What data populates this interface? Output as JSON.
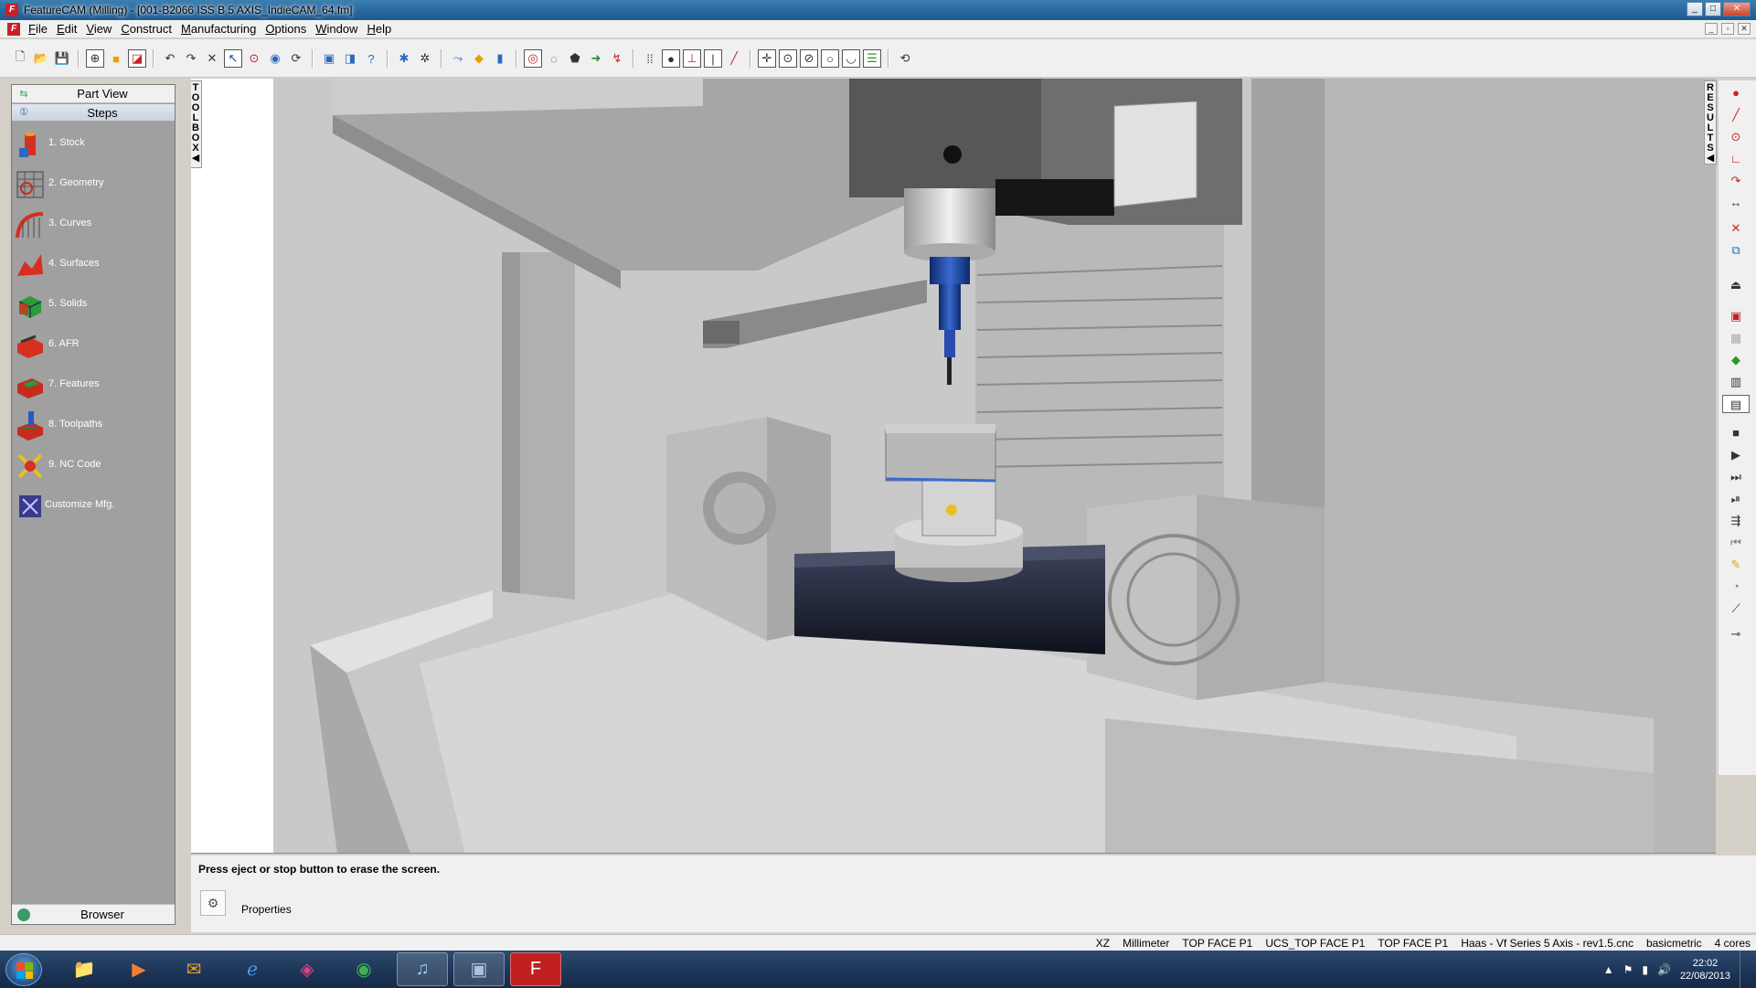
{
  "window": {
    "title": "FeatureCAM (Milling) - [001-B2066 ISS B 5 AXIS_IndieCAM_64.fm]",
    "controls": [
      "_",
      "□",
      "✕"
    ],
    "mdi_controls": [
      "_",
      "▫",
      "✕"
    ]
  },
  "menu": {
    "items": [
      "File",
      "Edit",
      "View",
      "Construct",
      "Manufacturing",
      "Options",
      "Window",
      "Help"
    ]
  },
  "left_panel": {
    "part_view_label": "Part View",
    "steps_label": "Steps",
    "steps": [
      {
        "label": "1.  Stock",
        "icon": "stock-icon"
      },
      {
        "label": "2.  Geometry",
        "icon": "geometry-icon"
      },
      {
        "label": "3.  Curves",
        "icon": "curves-icon"
      },
      {
        "label": "4.  Surfaces",
        "icon": "surfaces-icon"
      },
      {
        "label": "5.  Solids",
        "icon": "solids-icon"
      },
      {
        "label": "6.  AFR",
        "icon": "afr-icon"
      },
      {
        "label": "7.  Features",
        "icon": "features-icon"
      },
      {
        "label": "8.  Toolpaths",
        "icon": "toolpaths-icon"
      },
      {
        "label": "9.  NC Code",
        "icon": "nc-code-icon"
      },
      {
        "label": "Customize Mfg.",
        "icon": "customize-mfg-icon"
      }
    ],
    "browser_label": "Browser"
  },
  "toolbox_tab": {
    "letters": [
      "T",
      "O",
      "O",
      "L",
      "B",
      "O",
      "X",
      "◀"
    ]
  },
  "results_tab": {
    "letters": [
      "R",
      "E",
      "S",
      "U",
      "L",
      "T",
      "S",
      "◀"
    ]
  },
  "message": {
    "text": "Press eject or stop button to erase the screen.",
    "properties_label": "Properties"
  },
  "status": {
    "plane": "XZ",
    "units": "Millimeter",
    "setup": "TOP FACE P1",
    "ucs": "UCS_TOP FACE P1",
    "setup2": "TOP FACE P1",
    "post": "Haas - Vf Series 5 Axis - rev1.5.cnc",
    "template": "basicmetric",
    "cores": "4 cores"
  },
  "taskbar": {
    "time": "22:02",
    "date": "22/08/2013"
  },
  "colors": {
    "title_bar": "#2a6aa0",
    "panel_gray": "#a0a0a0",
    "machine_gray": "#bdbdbd",
    "tool_blue": "#1e4fa0",
    "trunnion_dark": "#1a1e2c"
  }
}
